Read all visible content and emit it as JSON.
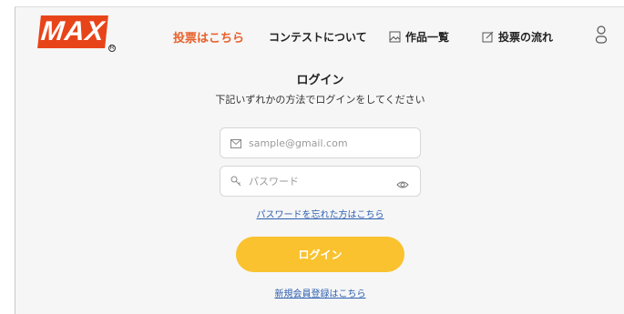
{
  "brand": {
    "logo_text": "MAX",
    "logo_mark": "R",
    "logo_color": "#e8441a"
  },
  "nav": {
    "vote": "投票はこちら",
    "contest": "コンテストについて",
    "works": "作品一覧",
    "flow": "投票の流れ",
    "works_icon": "image-icon",
    "flow_icon": "edit-icon",
    "user_icon": "user-icon",
    "accent_color": "#e8602a"
  },
  "login": {
    "title": "ログイン",
    "subtitle": "下記いずれかの方法でログインをしてください",
    "email_placeholder": "sample@gmail.com",
    "email_icon": "mail-icon",
    "password_placeholder": "パスワード",
    "password_icon": "key-icon",
    "password_toggle_icon": "eye-icon",
    "forgot_link": "パスワードを忘れた方はこちら",
    "submit_label": "ログイン",
    "submit_color": "#f9c22e",
    "register_link": "新規会員登録はこちら",
    "link_color": "#2d5fb0"
  }
}
